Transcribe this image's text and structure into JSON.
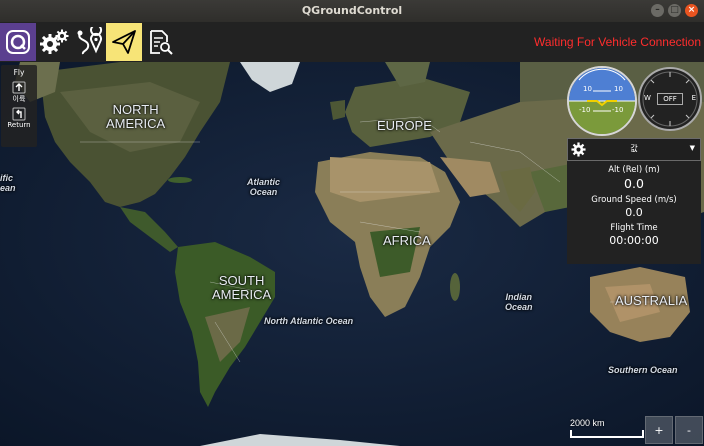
{
  "window": {
    "title": "QGroundControl",
    "buttons": {
      "minimize": "–",
      "maximize": "□",
      "close": "×"
    }
  },
  "toolbar": {
    "status": "Waiting For Vehicle Connection",
    "icons": [
      "qgc-logo-icon",
      "vehicle-setup-gear-icon",
      "plan-route-icon",
      "fly-paper-plane-icon",
      "analyze-document-icon"
    ],
    "active": "fly-paper-plane-icon",
    "colors": {
      "background": "#222222",
      "active": "#f7e477",
      "logo": "#5b3f8f",
      "status": "#ff2d2d"
    }
  },
  "fly_panel": {
    "header": "Fly",
    "items": [
      {
        "label": "이륙",
        "icon": "takeoff-icon"
      },
      {
        "label": "Return",
        "icon": "return-icon"
      }
    ]
  },
  "map": {
    "continents": [
      "NORTH\nAMERICA",
      "EUROPE",
      "AFRICA",
      "SOUTH\nAMERICA",
      "AUSTRALIA"
    ],
    "oceans": [
      "Atlantic\nOcean",
      "North Atlantic Ocean",
      "Indian\nOcean",
      "Southern Ocean",
      "ific\nean"
    ]
  },
  "instruments": {
    "attitude": {
      "pitch_labels": [
        "10",
        "10",
        "-10",
        "-10"
      ]
    },
    "compass": {
      "w": "W",
      "e": "E",
      "status": "OFF"
    }
  },
  "values": {
    "selector": "값",
    "items": [
      {
        "label": "Alt (Rel) (m)",
        "value": "0.0"
      },
      {
        "label": "Ground Speed (m/s)",
        "value": "0.0"
      },
      {
        "label": "Flight Time",
        "value": "00:00:00"
      }
    ]
  },
  "map_controls": {
    "scale_label": "2000 km",
    "zoom_in": "+",
    "zoom_out": "-"
  }
}
